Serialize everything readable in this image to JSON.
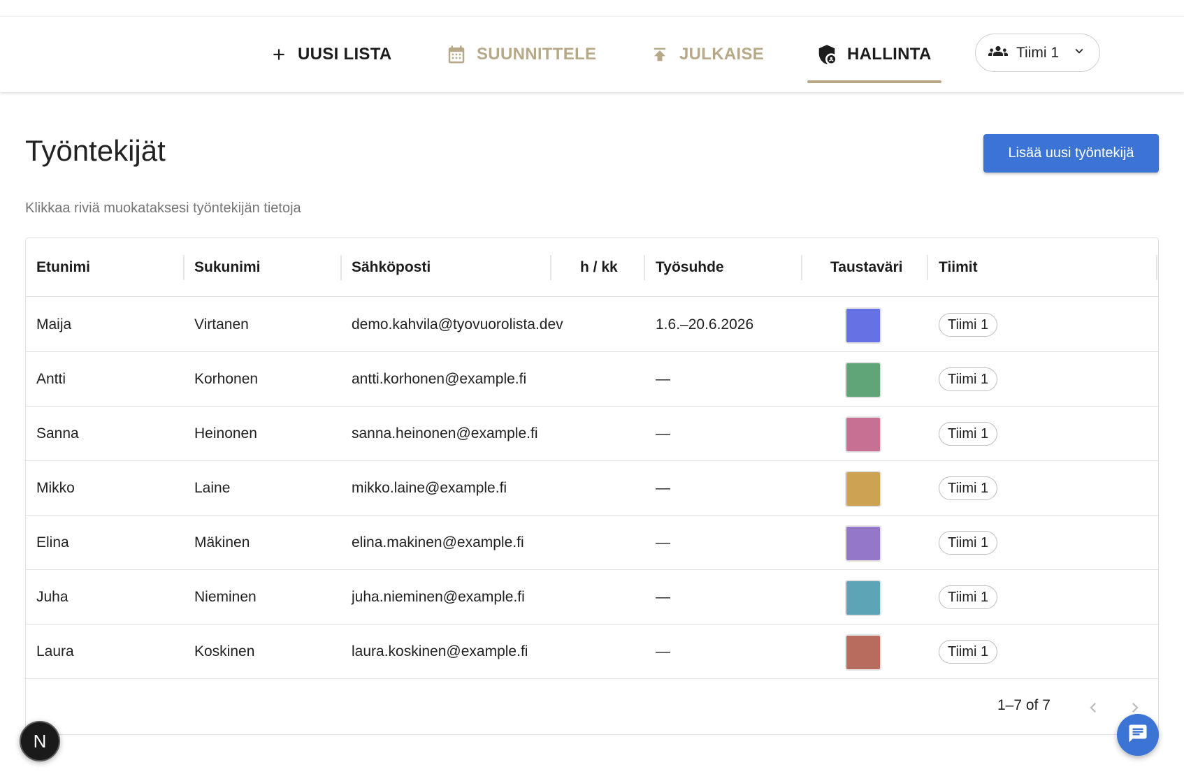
{
  "nav": {
    "new_list": "UUSI LISTA",
    "plan": "SUUNNITTELE",
    "publish": "JULKAISE",
    "admin": "HALLINTA",
    "team_select": "Tiimi 1"
  },
  "page": {
    "title": "Työntekijät",
    "add_button": "Lisää uusi työntekijä",
    "hint": "Klikkaa riviä muokataksesi työntekijän tietoja"
  },
  "table": {
    "columns": {
      "first_name": "Etunimi",
      "last_name": "Sukunimi",
      "email": "Sähköposti",
      "hours": "h / kk",
      "employment": "Työsuhde",
      "color": "Taustaväri",
      "teams": "Tiimit"
    },
    "rows": [
      {
        "first": "Maija",
        "last": "Virtanen",
        "email": "demo.kahvila@tyovuorolista.dev",
        "hours": "",
        "employment": "1.6.–20.6.2026",
        "color": "#6672e3",
        "team": "Tiimi 1"
      },
      {
        "first": "Antti",
        "last": "Korhonen",
        "email": "antti.korhonen@example.fi",
        "hours": "",
        "employment": "—",
        "color": "#5fa577",
        "team": "Tiimi 1"
      },
      {
        "first": "Sanna",
        "last": "Heinonen",
        "email": "sanna.heinonen@example.fi",
        "hours": "",
        "employment": "—",
        "color": "#c67094",
        "team": "Tiimi 1"
      },
      {
        "first": "Mikko",
        "last": "Laine",
        "email": "mikko.laine@example.fi",
        "hours": "",
        "employment": "—",
        "color": "#cda253",
        "team": "Tiimi 1"
      },
      {
        "first": "Elina",
        "last": "Mäkinen",
        "email": "elina.makinen@example.fi",
        "hours": "",
        "employment": "—",
        "color": "#9577c9",
        "team": "Tiimi 1"
      },
      {
        "first": "Juha",
        "last": "Nieminen",
        "email": "juha.nieminen@example.fi",
        "hours": "",
        "employment": "—",
        "color": "#5ea4b7",
        "team": "Tiimi 1"
      },
      {
        "first": "Laura",
        "last": "Koskinen",
        "email": "laura.koskinen@example.fi",
        "hours": "",
        "employment": "—",
        "color": "#b76c5d",
        "team": "Tiimi 1"
      }
    ],
    "pagination": "1–7 of 7"
  },
  "colors": {
    "accent_gold": "#b7a988",
    "primary_blue": "#3b74d5"
  },
  "icons": {
    "new_list": "plus-icon",
    "plan": "calendar-icon",
    "publish": "upload-icon",
    "admin": "shield-account-icon",
    "team": "group-icon",
    "dropdown": "chevron-down-icon",
    "prev": "chevron-left-icon",
    "next": "chevron-right-icon",
    "dev": "nextjs-icon",
    "chat": "chat-icon"
  },
  "dev_badge": "N"
}
